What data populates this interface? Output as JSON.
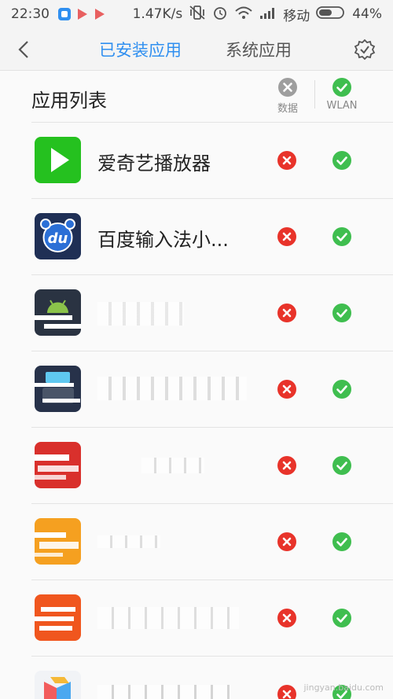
{
  "status_bar": {
    "time": "22:30",
    "speed": "1.47K/s",
    "carrier": "移动",
    "battery": "44%"
  },
  "nav": {
    "tabs": [
      {
        "label": "已安装应用",
        "active": true
      },
      {
        "label": "系统应用",
        "active": false
      }
    ]
  },
  "header": {
    "title": "应用列表",
    "col_data": "数据",
    "col_wlan": "WLAN"
  },
  "apps": [
    {
      "name": "爱奇艺播放器",
      "icon": "iqiyi-icon",
      "data": "blocked",
      "wlan": "allowed"
    },
    {
      "name": "百度输入法小...",
      "icon": "baidu-input-icon",
      "data": "blocked",
      "wlan": "allowed"
    },
    {
      "name": "",
      "icon": "android-app-icon",
      "data": "blocked",
      "wlan": "allowed"
    },
    {
      "name": "",
      "icon": "keyboard-app-icon",
      "data": "blocked",
      "wlan": "allowed"
    },
    {
      "name": "",
      "icon": "red-app-icon",
      "data": "blocked",
      "wlan": "allowed"
    },
    {
      "name": "",
      "icon": "orange-app-icon",
      "data": "blocked",
      "wlan": "allowed"
    },
    {
      "name": "",
      "icon": "orange-red-app-icon",
      "data": "blocked",
      "wlan": "allowed"
    },
    {
      "name": "",
      "icon": "colorful-app-icon",
      "data": "blocked",
      "wlan": "allowed"
    }
  ],
  "colors": {
    "accent": "#2f8ff0",
    "blocked": "#e8332a",
    "allowed": "#3fbe4f",
    "neutral": "#9e9e9e"
  },
  "watermark": "jingyan.baidu.com"
}
